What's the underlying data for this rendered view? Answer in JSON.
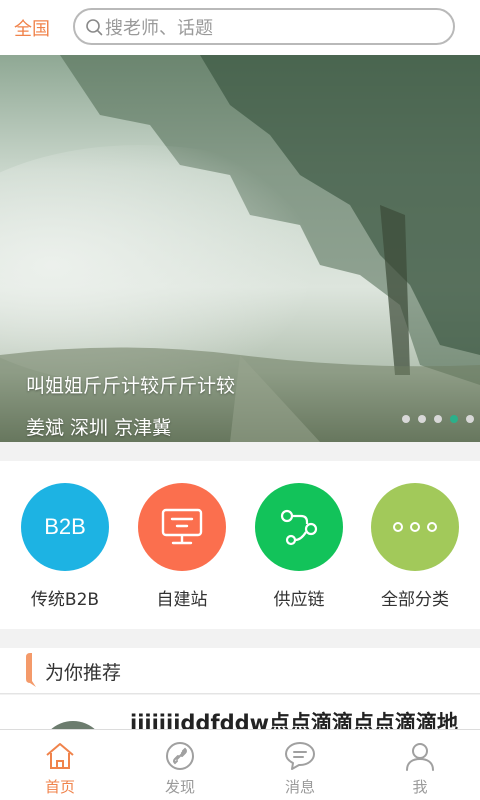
{
  "header": {
    "region_label": "全国",
    "search_placeholder": "搜老师、话题",
    "accent_color": "#f0834b"
  },
  "banner": {
    "title": "叫姐姐斤斤计较斤斤计较",
    "subtitle": "姜斌 深圳 京津冀",
    "dot_count": 5,
    "active_dot_index": 3
  },
  "categories": [
    {
      "label": "传统B2B",
      "icon": "b2b-icon",
      "icon_text": "B2B",
      "color": "#1db3e3"
    },
    {
      "label": "自建站",
      "icon": "monitor-icon",
      "color": "#fb6f4e"
    },
    {
      "label": "供应链",
      "icon": "supply-chain-icon",
      "color": "#12c35a"
    },
    {
      "label": "全部分类",
      "icon": "more-dots-icon",
      "color": "#a2c95a"
    }
  ],
  "recommend": {
    "section_title": "为你推荐",
    "items": [
      {
        "title": "jjjjjjjddfddw点点滴滴点点滴滴地"
      }
    ]
  },
  "tabbar": {
    "tabs": [
      {
        "label": "首页",
        "icon": "home-icon",
        "active": true
      },
      {
        "label": "发现",
        "icon": "discover-link-icon",
        "active": false
      },
      {
        "label": "消息",
        "icon": "message-bubble-icon",
        "active": false
      },
      {
        "label": "我",
        "icon": "user-profile-icon",
        "active": false
      }
    ]
  }
}
